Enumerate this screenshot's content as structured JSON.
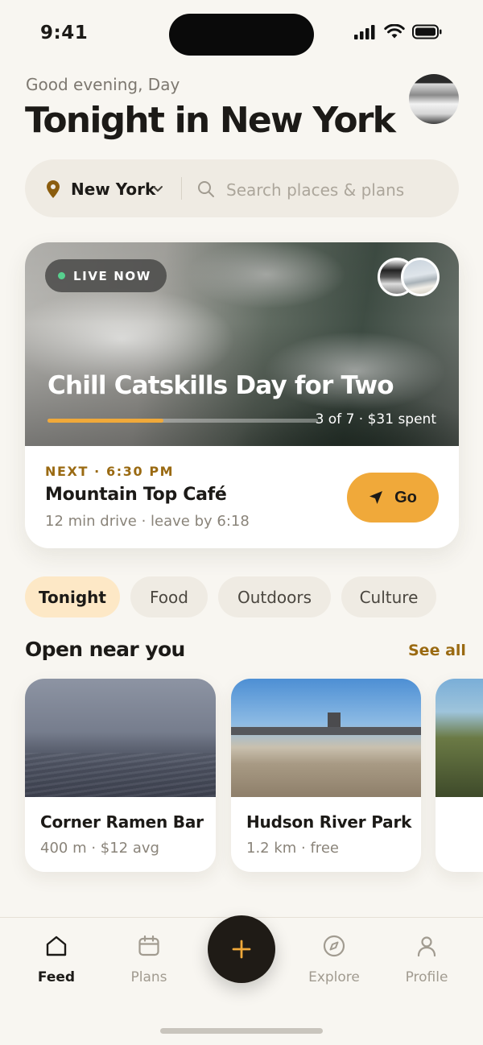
{
  "status_bar": {
    "time": "9:41"
  },
  "header": {
    "greeting": "Good evening, Day",
    "title": "Tonight in New York"
  },
  "search": {
    "location": "New York",
    "placeholder": "Search places & plans"
  },
  "hero": {
    "badge": "LIVE NOW",
    "title": "Chill Catskills Day for Two",
    "progress": {
      "completed": 3,
      "total": 7,
      "fraction": 0.43
    },
    "progress_text": "3 of 7 · $31 spent",
    "next_label": "NEXT · 6:30 PM",
    "next_place": "Mountain Top Café",
    "next_detail": "12 min drive · leave by 6:18",
    "go_label": "Go"
  },
  "chips": [
    {
      "label": "Tonight",
      "active": true
    },
    {
      "label": "Food",
      "active": false
    },
    {
      "label": "Outdoors",
      "active": false
    },
    {
      "label": "Culture",
      "active": false
    }
  ],
  "section": {
    "title": "Open near you",
    "see_all": "See all"
  },
  "places": [
    {
      "name": "Corner Ramen Bar",
      "meta": "400 m · $12 avg"
    },
    {
      "name": "Hudson River Park",
      "meta": "1.2 km · free"
    }
  ],
  "nav": {
    "items": [
      {
        "label": "Feed",
        "icon": "home-icon",
        "active": true
      },
      {
        "label": "Plans",
        "icon": "calendar-icon",
        "active": false
      },
      {
        "label": "Explore",
        "icon": "compass-icon",
        "active": false
      },
      {
        "label": "Profile",
        "icon": "user-icon",
        "active": false
      }
    ],
    "fab_icon": "plus-icon"
  },
  "colors": {
    "accent": "#f0a93a",
    "accent_text": "#9a6a12",
    "background": "#f8f6f1",
    "live_dot": "#57d08e",
    "active_chip": "#fde8c6"
  }
}
